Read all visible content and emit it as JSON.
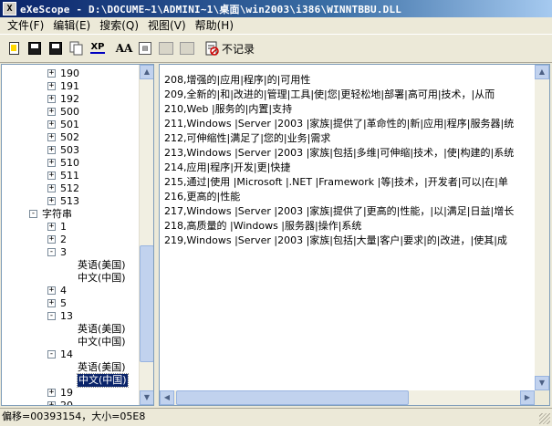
{
  "window": {
    "title": "eXeScope - D:\\DOCUME~1\\ADMINI~1\\桌面\\win2003\\i386\\WINNTBBU.DLL",
    "app_icon": "X"
  },
  "menu": [
    {
      "label": "文件(F)"
    },
    {
      "label": "编辑(E)"
    },
    {
      "label": "搜索(Q)"
    },
    {
      "label": "视图(V)"
    },
    {
      "label": "帮助(H)"
    }
  ],
  "toolbar": {
    "icons": [
      "open-icon",
      "save-icon",
      "save-all-icon",
      "copy-icon",
      "xp-icon",
      "font-icon",
      "resource-icon",
      "export-icon",
      "import-icon"
    ],
    "xp_label": "XP",
    "font_label": "AA",
    "nolog_label": "不记录"
  },
  "tree": {
    "items": [
      {
        "label": "190",
        "expander": "+",
        "indent": 0
      },
      {
        "label": "191",
        "expander": "+",
        "indent": 0
      },
      {
        "label": "192",
        "expander": "+",
        "indent": 0
      },
      {
        "label": "500",
        "expander": "+",
        "indent": 0
      },
      {
        "label": "501",
        "expander": "+",
        "indent": 0
      },
      {
        "label": "502",
        "expander": "+",
        "indent": 0
      },
      {
        "label": "503",
        "expander": "+",
        "indent": 0
      },
      {
        "label": "510",
        "expander": "+",
        "indent": 0
      },
      {
        "label": "511",
        "expander": "+",
        "indent": 0
      },
      {
        "label": "512",
        "expander": "+",
        "indent": 0
      },
      {
        "label": "513",
        "expander": "+",
        "indent": 0
      },
      {
        "label": "字符串",
        "expander": "-",
        "indent": -1
      },
      {
        "label": "1",
        "expander": "+",
        "indent": 0
      },
      {
        "label": "2",
        "expander": "+",
        "indent": 0
      },
      {
        "label": "3",
        "expander": "-",
        "indent": 0
      },
      {
        "label": "英语(美国)",
        "expander": "",
        "indent": 1
      },
      {
        "label": "中文(中国)",
        "expander": "",
        "indent": 1
      },
      {
        "label": "4",
        "expander": "+",
        "indent": 0
      },
      {
        "label": "5",
        "expander": "+",
        "indent": 0
      },
      {
        "label": "13",
        "expander": "-",
        "indent": 0
      },
      {
        "label": "英语(美国)",
        "expander": "",
        "indent": 1
      },
      {
        "label": "中文(中国)",
        "expander": "",
        "indent": 1
      },
      {
        "label": "14",
        "expander": "-",
        "indent": 0
      },
      {
        "label": "英语(美国)",
        "expander": "",
        "indent": 1
      },
      {
        "label": "中文(中国)",
        "expander": "",
        "indent": 1,
        "selected": true
      },
      {
        "label": "19",
        "expander": "+",
        "indent": 0
      },
      {
        "label": "20",
        "expander": "+",
        "indent": 0
      }
    ]
  },
  "content": {
    "lines": [
      "208,增强的|应用|程序|的|可用性",
      "209,全新的|和|改进的|管理|工具|使|您|更轻松地|部署|高可用|技术，|从而",
      "210,Web |服务的|内置|支持",
      "211,Windows |Server |2003 |家族|提供了|革命性的|新|应用|程序|服务器|统",
      "212,可伸缩性|满足了|您的|业务|需求",
      "213,Windows |Server |2003 |家族|包括|多维|可伸缩|技术，|使|构建的|系统",
      "214,应用|程序|开发|更|快捷",
      "215,通过|使用 |Microsoft |.NET |Framework |等|技术，|开发者|可以|在|单",
      "216,更高的|性能",
      "217,Windows |Server |2003 |家族|提供了|更高的|性能，|以|满足|日益|增长",
      "218,高质量的 |Windows |服务器|操作|系统",
      "219,Windows |Server |2003 |家族|包括|大量|客户|要求|的|改进，|使其|成"
    ]
  },
  "status": {
    "text": "偏移=00393154，大小=05E8"
  }
}
